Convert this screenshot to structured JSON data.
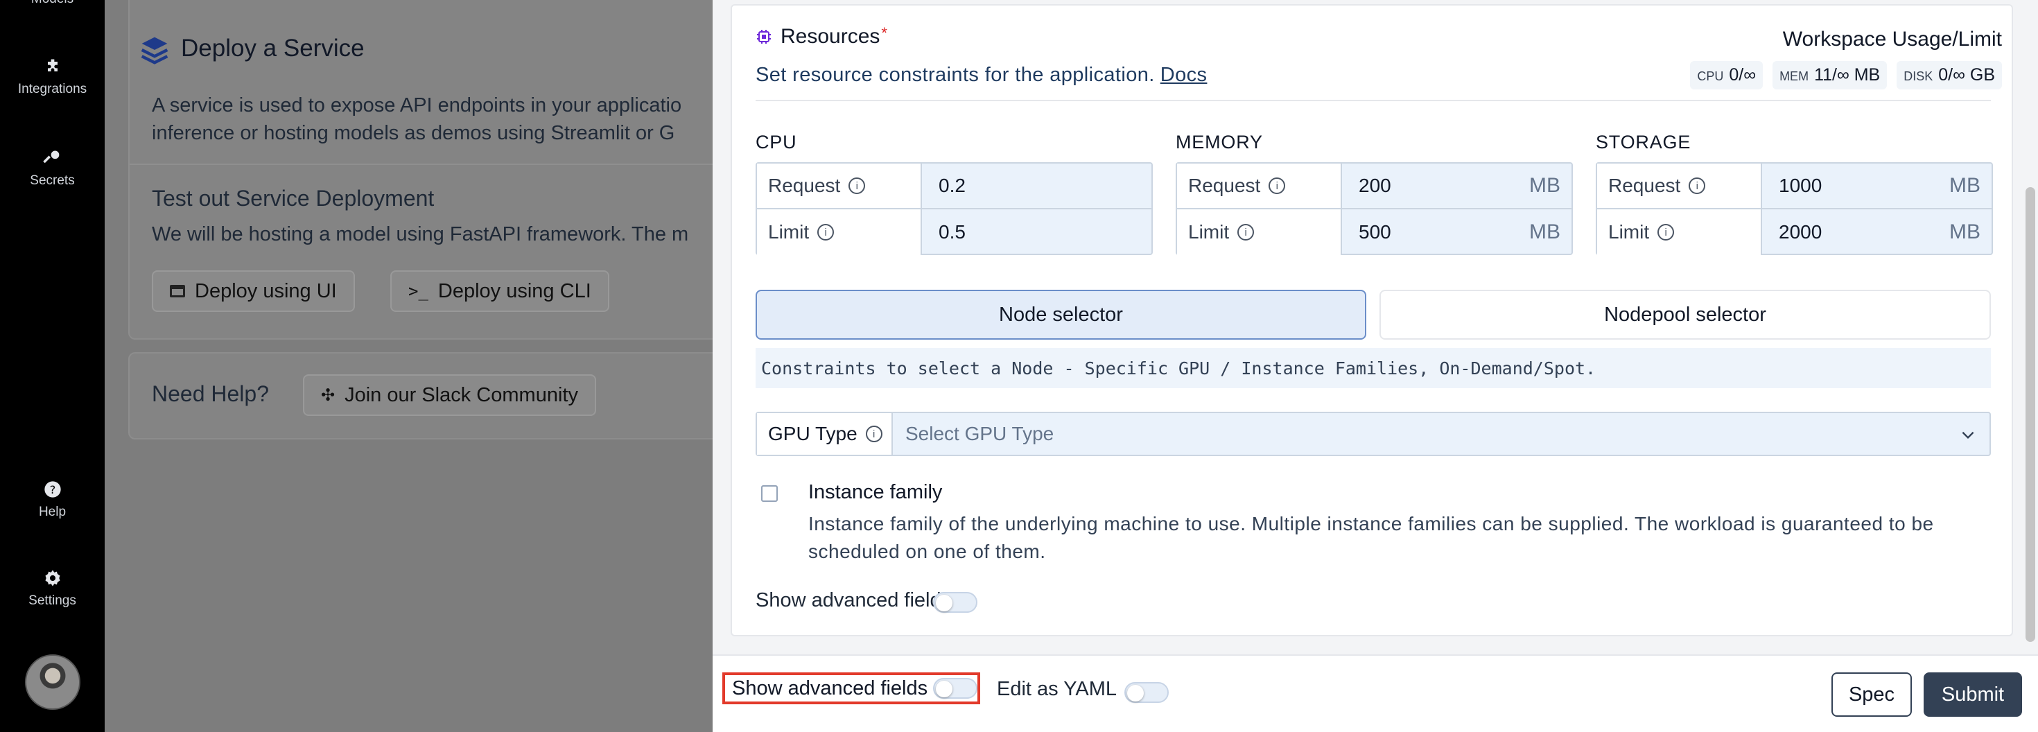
{
  "sidebar": {
    "items": [
      {
        "label": "Models",
        "icon": "models-icon"
      },
      {
        "label": "Integrations",
        "icon": "puzzle-icon"
      },
      {
        "label": "Secrets",
        "icon": "key-icon"
      },
      {
        "label": "Help",
        "icon": "help-icon"
      },
      {
        "label": "Settings",
        "icon": "gear-icon"
      }
    ]
  },
  "background": {
    "deploy_title": "Deploy a Service",
    "deploy_desc_1": "A service is used to expose API endpoints in your applicatio",
    "deploy_desc_2": "inference or hosting models as demos using Streamlit or G",
    "test_title": "Test out Service Deployment",
    "test_desc": "We will be hosting a model using FastAPI framework. The m",
    "btn_ui": "Deploy using UI",
    "btn_cli": "Deploy using CLI",
    "help_title": "Need Help?",
    "btn_slack": "Join our Slack Community"
  },
  "resources": {
    "title": "Resources",
    "required_mark": "*",
    "description": "Set resource constraints for the application.",
    "docs_link": "Docs",
    "usage_title": "Workspace Usage/Limit",
    "usage": [
      {
        "key": "CPU",
        "value": "0/∞"
      },
      {
        "key": "MEM",
        "value": "11/∞ MB"
      },
      {
        "key": "DISK",
        "value": "0/∞ GB"
      }
    ],
    "groups": {
      "cpu": {
        "label": "CPU",
        "request_label": "Request",
        "request": "0.2",
        "limit_label": "Limit",
        "limit": "0.5",
        "unit": ""
      },
      "memory": {
        "label": "MEMORY",
        "request_label": "Request",
        "request": "200",
        "limit_label": "Limit",
        "limit": "500",
        "unit": "MB"
      },
      "storage": {
        "label": "STORAGE",
        "request_label": "Request",
        "request": "1000",
        "limit_label": "Limit",
        "limit": "2000",
        "unit": "MB"
      }
    },
    "node_selector": "Node selector",
    "nodepool_selector": "Nodepool selector",
    "constraint_hint": "Constraints to select a Node - Specific GPU / Instance Families, On-Demand/Spot.",
    "gpu_label": "GPU Type",
    "gpu_placeholder": "Select GPU Type",
    "instance_family_title": "Instance family",
    "instance_family_desc": "Instance family of the underlying machine to use. Multiple instance families can be supplied. The workload is guaranteed to be scheduled on one of them.",
    "show_advanced": "Show advanced fields"
  },
  "footer": {
    "show_advanced": "Show advanced fields",
    "edit_yaml": "Edit as YAML",
    "spec": "Spec",
    "submit": "Submit"
  },
  "colors": {
    "primary": "#334155",
    "selected": "#e3ecf9",
    "highlight": "#e23a2b"
  }
}
